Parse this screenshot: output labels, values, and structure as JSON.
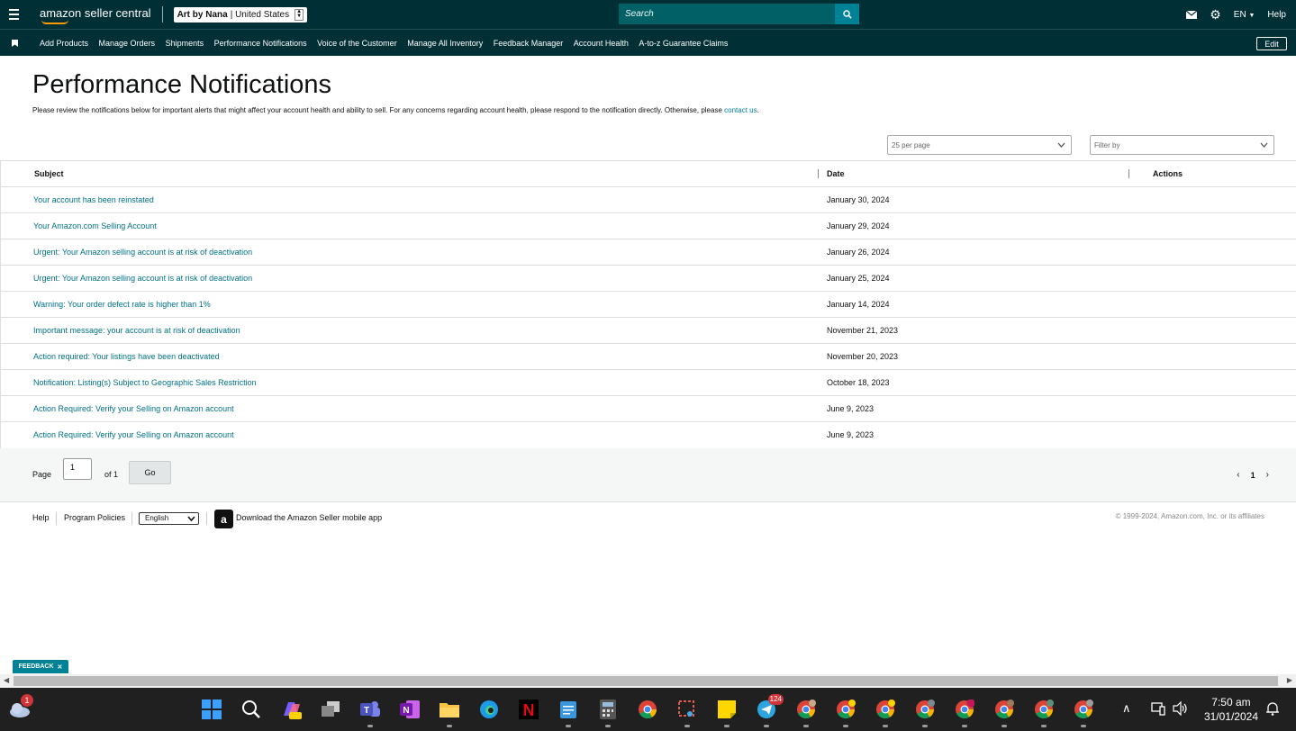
{
  "header": {
    "logo_text": "amazon seller central",
    "store_name": "Art by Nana",
    "store_region": "United States",
    "search_placeholder": "Search",
    "language": "EN",
    "help_label": "Help"
  },
  "nav": {
    "items": [
      "Add Products",
      "Manage Orders",
      "Shipments",
      "Performance Notifications",
      "Voice of the Customer",
      "Manage All Inventory",
      "Feedback Manager",
      "Account Health",
      "A-to-z Guarantee Claims"
    ],
    "edit_label": "Edit"
  },
  "page": {
    "title": "Performance Notifications",
    "description": "Please review the notifications below for important alerts that might affect your account health and ability to sell. For any concerns regarding account health, please respond to the notification directly. Otherwise, please",
    "contact_link": "contact us",
    "description_end": "."
  },
  "controls": {
    "per_page": "25 per page",
    "filter_placeholder": "Filter by"
  },
  "table": {
    "columns": [
      "Subject",
      "Date",
      "Actions"
    ],
    "rows": [
      {
        "subject": "Your account has been reinstated",
        "date": "January 30, 2024"
      },
      {
        "subject": "Your Amazon.com Selling Account",
        "date": "January 29, 2024"
      },
      {
        "subject": "Urgent: Your Amazon selling account is at risk of deactivation",
        "date": "January 26, 2024"
      },
      {
        "subject": "Urgent: Your Amazon selling account is at risk of deactivation",
        "date": "January 25, 2024"
      },
      {
        "subject": "Warning: Your order defect rate is higher than 1%",
        "date": "January 14, 2024"
      },
      {
        "subject": "Important message: your account is at risk of deactivation",
        "date": "November 21, 2023"
      },
      {
        "subject": "Action required: Your listings have been deactivated",
        "date": "November 20, 2023"
      },
      {
        "subject": "Notification: Listing(s) Subject to Geographic Sales Restriction",
        "date": "October 18, 2023"
      },
      {
        "subject": "Action Required: Verify your Selling on Amazon account",
        "date": "June 9, 2023"
      },
      {
        "subject": "Action Required: Verify your Selling on Amazon account",
        "date": "June 9, 2023"
      }
    ]
  },
  "pagination": {
    "page_label": "Page",
    "current_page": "1",
    "of_label": "of 1",
    "go_label": "Go",
    "page_number": "1"
  },
  "footer": {
    "help": "Help",
    "policies": "Program Policies",
    "language_select": "English",
    "app_link": "Download the Amazon Seller mobile app",
    "copyright": "© 1999-2024, Amazon.com, Inc. or its affiliates"
  },
  "feedback_label": "FEEDBACK",
  "taskbar": {
    "weather_badge": "1",
    "telegram_badge": "124",
    "time": "7:50 am",
    "date": "31/01/2024"
  },
  "colors": {
    "topbar": "#002f36",
    "link": "#007185",
    "accent": "#008296"
  }
}
